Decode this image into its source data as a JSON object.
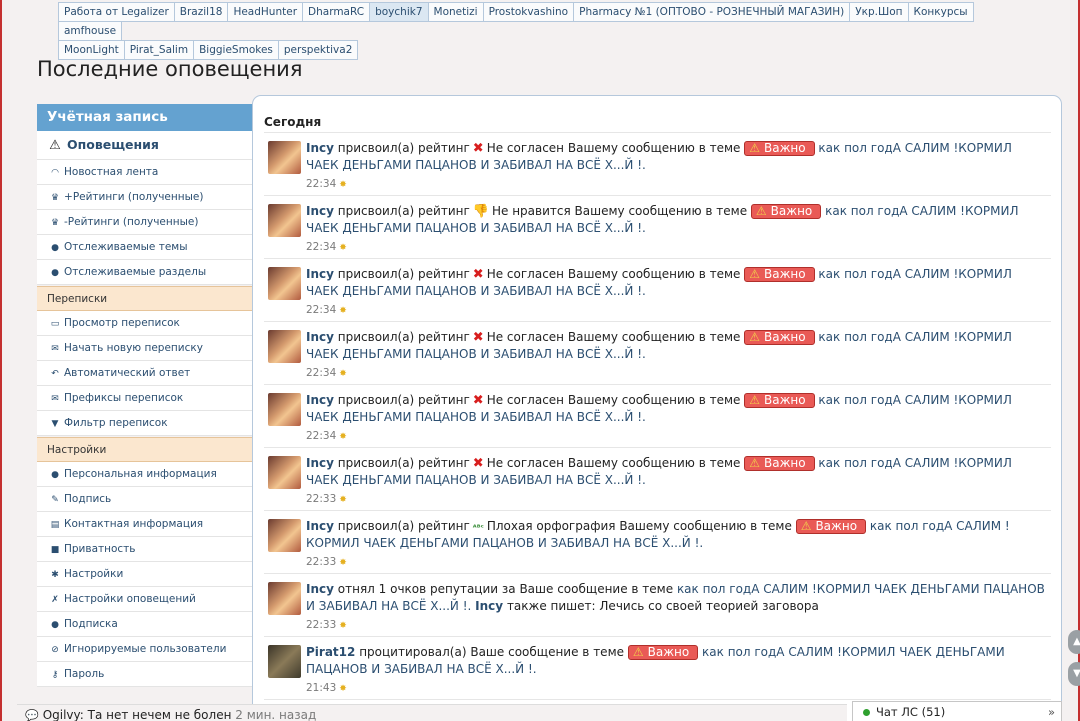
{
  "tabs": {
    "row1": [
      "Работа от Legalizer",
      "Brazil18",
      "HeadHunter",
      "DharmaRC",
      "boychik7",
      "Monetizi",
      "Prostokvashino",
      "Pharmacy №1 (ОПТОВО - РОЗНЕЧНЫЙ МАГАЗИН)",
      "Укр.Шоп",
      "Конкурсы",
      "amfhouse"
    ],
    "row2": [
      "MoonLight",
      "Pirat_Salim",
      "BiggieSmokes",
      "perspektiva2"
    ],
    "active": "boychik7"
  },
  "page_title": "Последние оповещения",
  "sidebar": {
    "header": "Учётная запись",
    "active_item": {
      "icon": "warning-icon",
      "label": "Оповещения"
    },
    "items": [
      {
        "icon": "rss-icon",
        "label": "Новостная лента"
      },
      {
        "icon": "trophy-plus-icon",
        "label": "Рейтинги (полученные)",
        "prefix": "+"
      },
      {
        "icon": "trophy-minus-icon",
        "label": "Рейтинги (полученные)",
        "prefix": "-"
      },
      {
        "icon": "comment-icon",
        "label": "Отслеживаемые темы"
      },
      {
        "icon": "comments-icon",
        "label": "Отслеживаемые разделы"
      }
    ],
    "section_conv": "Переписки",
    "conv_items": [
      {
        "icon": "inbox-icon",
        "label": "Просмотр переписок"
      },
      {
        "icon": "envelope-icon",
        "label": "Начать новую переписку"
      },
      {
        "icon": "reply-icon",
        "label": "Автоматический ответ"
      },
      {
        "icon": "envelope-outline-icon",
        "label": "Префиксы переписок"
      },
      {
        "icon": "filter-icon",
        "label": "Фильтр переписок"
      }
    ],
    "section_settings": "Настройки",
    "settings_items": [
      {
        "icon": "user-icon",
        "label": "Персональная информация"
      },
      {
        "icon": "pencil-icon",
        "label": "Подпись"
      },
      {
        "icon": "contact-icon",
        "label": "Контактная информация"
      },
      {
        "icon": "lock-icon",
        "label": "Приватность"
      },
      {
        "icon": "gear-icon",
        "label": "Настройки"
      },
      {
        "icon": "wrench-icon",
        "label": "Настройки оповещений"
      },
      {
        "icon": "users-icon",
        "label": "Подписка"
      },
      {
        "icon": "ban-icon",
        "label": "Игнорируемые пользователи"
      },
      {
        "icon": "key-icon",
        "label": "Пароль"
      }
    ]
  },
  "content": {
    "section_title": "Сегодня",
    "thread_title": "как пол годА САЛИМ !КОРМИЛ ЧАЕК ДЕНЬГАМИ ПАЦАНОВ И ЗАБИВАЛ НА ВСЁ Х...Й !.",
    "badge_label": "Важно",
    "notifications": [
      {
        "user": "Incy",
        "action": "присвоил(а) рейтинг",
        "rating_icon": "x-icon",
        "rating": "Не согласен",
        "mid": "Вашему сообщению в теме",
        "time": "22:34"
      },
      {
        "user": "Incy",
        "action": "присвоил(а) рейтинг",
        "rating_icon": "thumbs-down-icon",
        "rating": "Не нравится",
        "mid": "Вашему сообщению в теме",
        "time": "22:34"
      },
      {
        "user": "Incy",
        "action": "присвоил(а) рейтинг",
        "rating_icon": "x-icon",
        "rating": "Не согласен",
        "mid": "Вашему сообщению в теме",
        "time": "22:34"
      },
      {
        "user": "Incy",
        "action": "присвоил(а) рейтинг",
        "rating_icon": "x-icon",
        "rating": "Не согласен",
        "mid": "Вашему сообщению в теме",
        "time": "22:34"
      },
      {
        "user": "Incy",
        "action": "присвоил(а) рейтинг",
        "rating_icon": "x-icon",
        "rating": "Не согласен",
        "mid": "Вашему сообщению в теме",
        "time": "22:34"
      },
      {
        "user": "Incy",
        "action": "присвоил(а) рейтинг",
        "rating_icon": "x-icon",
        "rating": "Не согласен",
        "mid": "Вашему сообщению в теме",
        "time": "22:33"
      },
      {
        "user": "Incy",
        "action": "присвоил(а) рейтинг",
        "rating_icon": "abc-icon",
        "rating": "Плохая орфография",
        "mid": "Вашему сообщению в теме",
        "time": "22:33"
      }
    ],
    "rep": {
      "user": "Incy",
      "text": "отнял 1 очков репутации за Ваше сообщение в теме",
      "user2": "Incy",
      "also": "также пишет:",
      "quote": "Лечись со своей теорией заговора",
      "time": "22:33"
    },
    "quoted": {
      "user": "Pirat12",
      "text": "процитировал(а) Ваше сообщение в теме",
      "time": "21:43"
    }
  },
  "bottom": {
    "user": "Ogilvy:",
    "message": "Та нет нечем не болен",
    "ago": "2 мин. назад"
  },
  "chat": {
    "label": "Чат ЛС",
    "count": "(51)"
  },
  "colors": {
    "accent": "#64a2d0",
    "link": "#2b4e70",
    "badge": "#e95a56",
    "section": "#fbe7cf"
  }
}
